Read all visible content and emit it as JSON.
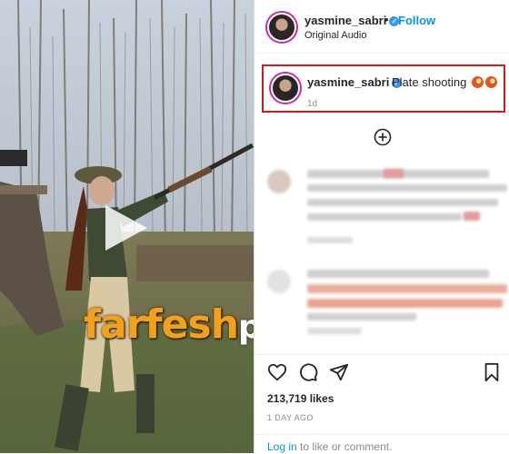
{
  "post": {
    "username": "yasmine_sabri",
    "follow_label": "Follow",
    "dot": "•",
    "audio": "Original Audio",
    "caption": {
      "username": "yasmine_sabri",
      "text": "Plate shooting",
      "time": "1d"
    },
    "likes": "213,719 likes",
    "posted_ago": "1 DAY AGO",
    "login_link": "Log in",
    "login_suffix": " to like or comment."
  },
  "media": {
    "watermark_main": "farfesh",
    "watermark_suffix": "plus.com",
    "has_play_button": true
  },
  "icons": {
    "add_comments": "plus-circle-icon",
    "like": "heart-icon",
    "comment": "comment-icon",
    "share": "paper-plane-icon",
    "save": "bookmark-icon",
    "verified": "verified-badge-icon"
  },
  "colors": {
    "accent_blue": "#0095f6",
    "highlight_red": "#d11a1a",
    "watermark_orange": "#f2a11c"
  }
}
